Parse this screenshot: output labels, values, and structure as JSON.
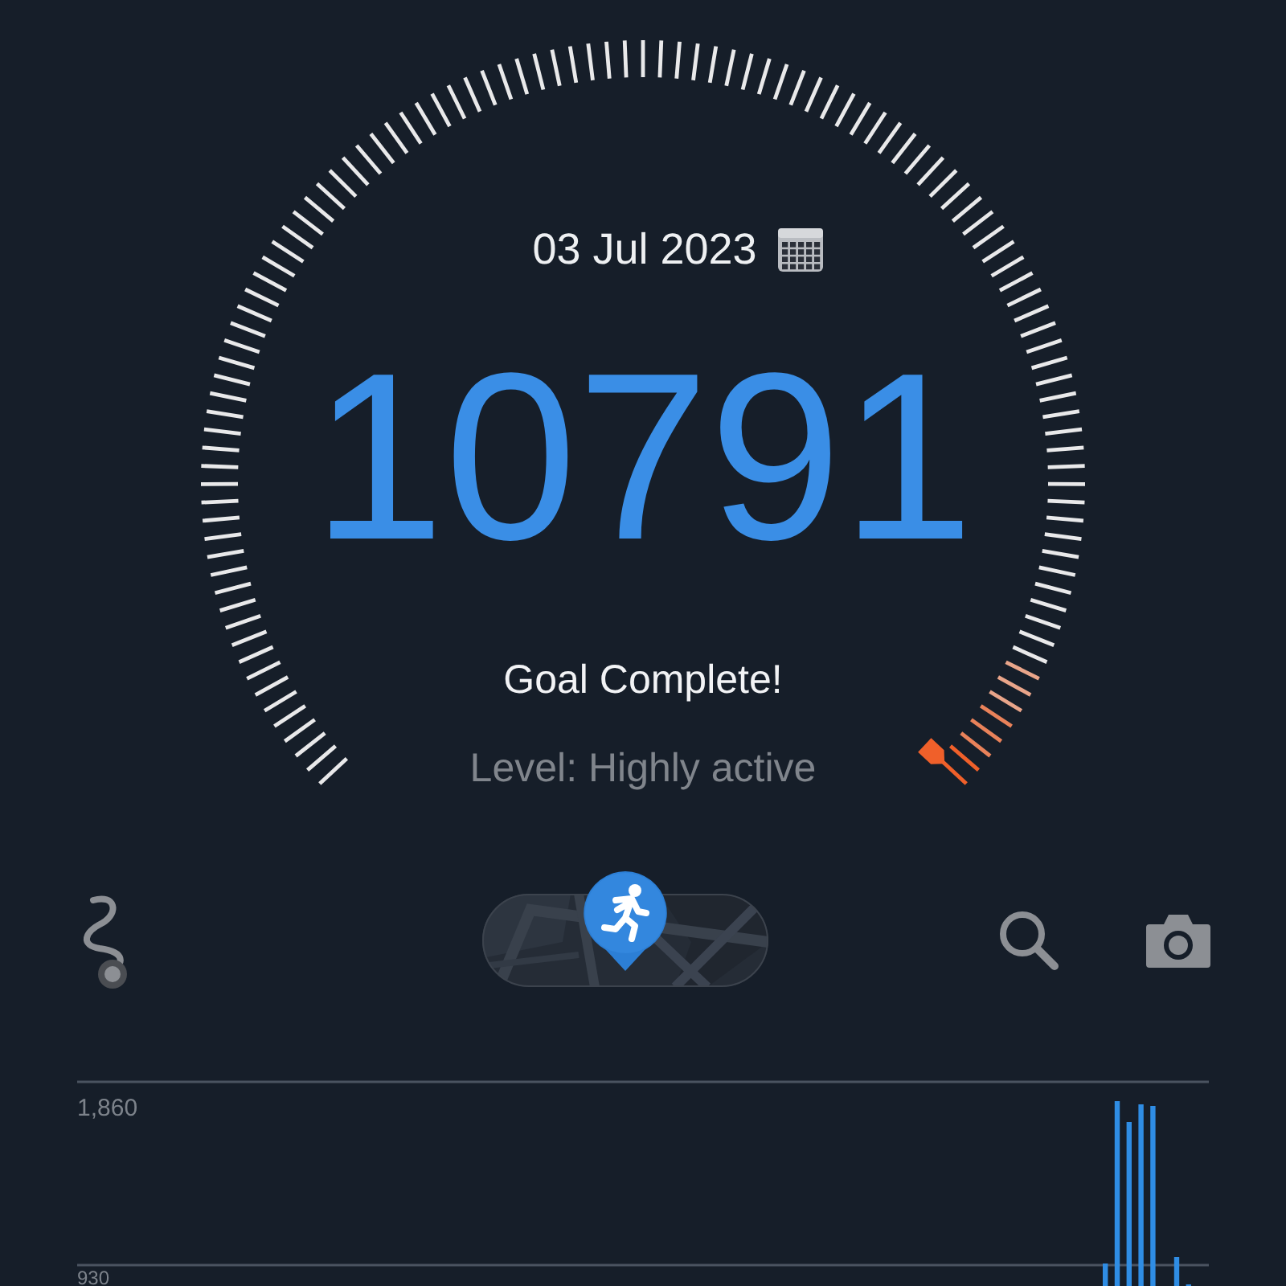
{
  "gauge": {
    "date": "03 Jul 2023",
    "steps": "10791",
    "status": "Goal Complete!",
    "activity": "Level: Highly active"
  },
  "chart": {
    "axis_labels": [
      "1,860",
      "930"
    ]
  }
}
